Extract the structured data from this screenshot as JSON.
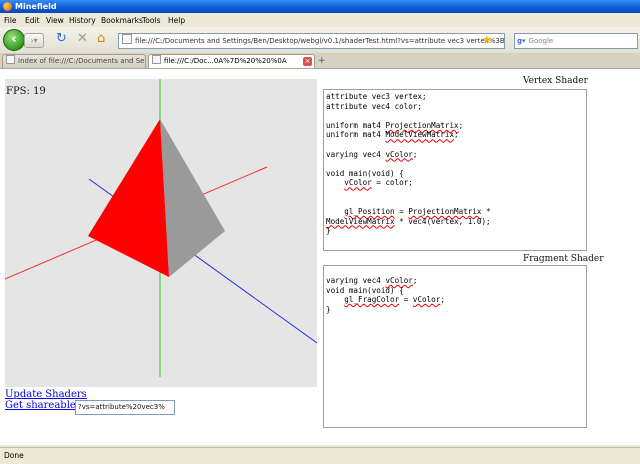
{
  "window": {
    "title": "Minefield"
  },
  "menu": [
    "File",
    "Edit",
    "View",
    "History",
    "Bookmarks",
    "Tools",
    "Help"
  ],
  "nav": {
    "url": "file:///C:/Documents and Settings/Ben/Desktop/webgl/v0.1/shaderTest.html?vs=attribute vec3 vertex%3B%0Aattri",
    "search_placeholder": "Google"
  },
  "tabs": [
    {
      "label": "Index of file:///C:/Documents and Settin..."
    },
    {
      "label": "file:///C:/Doc...0A%7D%20%20%0A"
    }
  ],
  "canvas": {
    "fps_label": "FPS: 19"
  },
  "links": {
    "update": "Update Shaders",
    "share": "Get shareable URL"
  },
  "share_value": "?vs=attribute%20vec3%",
  "vertex_shader": {
    "label": "Vertex Shader",
    "lines": [
      "attribute vec3 vertex;",
      "attribute vec4 color;",
      "",
      "uniform mat4 ProjectionMatrix;",
      "uniform mat4 ModelViewMatrix;",
      "",
      "varying vec4 vColor;",
      "",
      "void main(void) {",
      "    vColor = color;",
      "",
      "",
      "    gl_Position = ProjectionMatrix *",
      "ModelViewMatrix * vec4(vertex, 1.0);",
      "}"
    ]
  },
  "fragment_shader": {
    "label": "Fragment Shader",
    "lines": [
      "varying vec4 vColor;",
      "void main(void) {",
      "    gl_FragColor = vColor;",
      "}"
    ]
  },
  "status": {
    "text": "Done"
  },
  "colors": {
    "red_face": "#ff0000",
    "gray_face": "#9a9a9a",
    "axis_x": "#ff2a2a",
    "axis_y": "#22cc22",
    "axis_z": "#2a2aee"
  },
  "icons": [
    "back-icon",
    "forward-icon",
    "reload-icon",
    "stop-icon",
    "home-icon",
    "bookmark-star-icon",
    "google-icon",
    "tab-close-icon",
    "new-tab-icon"
  ]
}
